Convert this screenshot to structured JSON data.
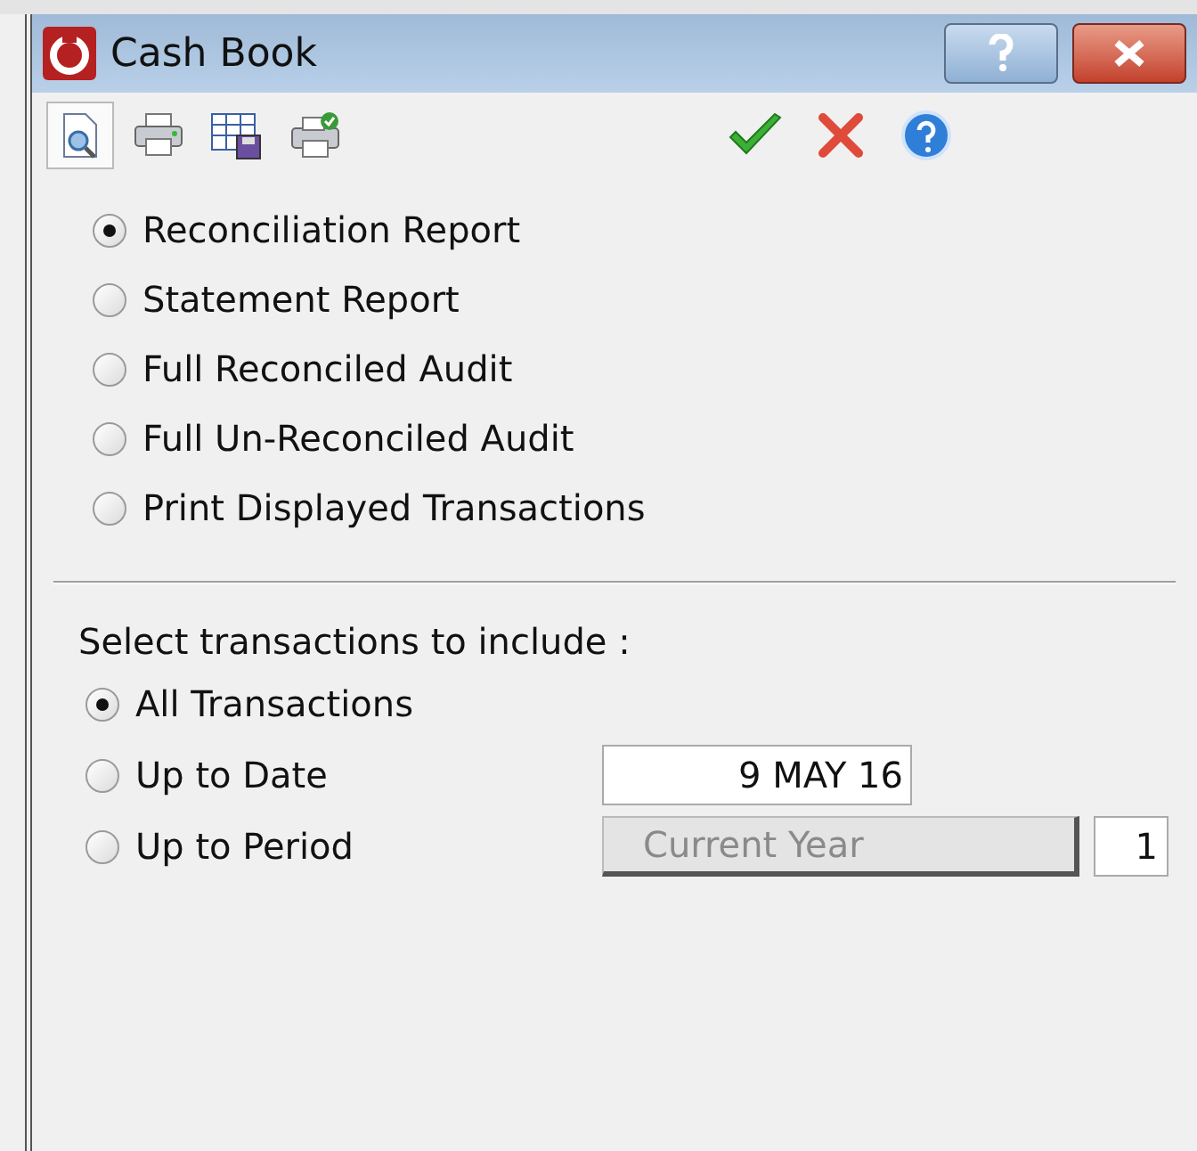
{
  "window": {
    "title": "Cash Book"
  },
  "toolbar": {
    "left_tools": [
      {
        "kind": "preview",
        "selected": true
      },
      {
        "kind": "print",
        "selected": false
      },
      {
        "kind": "export",
        "selected": false
      },
      {
        "kind": "print-ok",
        "selected": false
      }
    ],
    "right_tools": [
      {
        "kind": "ok"
      },
      {
        "kind": "cancel"
      },
      {
        "kind": "help"
      }
    ]
  },
  "report_types": [
    {
      "label": "Reconciliation Report",
      "selected": true
    },
    {
      "label": "Statement Report",
      "selected": false
    },
    {
      "label": "Full Reconciled Audit",
      "selected": false
    },
    {
      "label": "Full Un-Reconciled Audit",
      "selected": false
    },
    {
      "label": "Print Displayed Transactions",
      "selected": false
    }
  ],
  "include": {
    "heading": "Select transactions to include :",
    "options": [
      {
        "label": "All Transactions",
        "selected": true,
        "kind": "plain"
      },
      {
        "label": "Up to Date",
        "selected": false,
        "kind": "date",
        "value": "9 MAY 16"
      },
      {
        "label": "Up to Period",
        "selected": false,
        "kind": "period",
        "button": "Current Year",
        "disabled": true,
        "value": "1"
      }
    ]
  }
}
